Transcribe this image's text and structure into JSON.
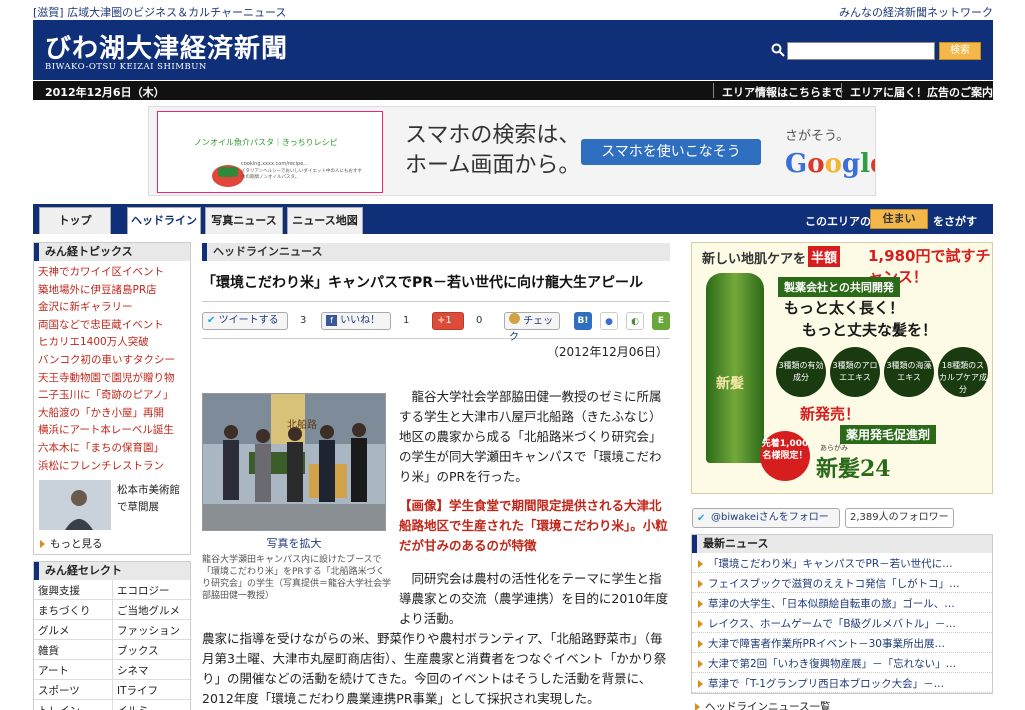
{
  "topbar": {
    "left": "[滋賀] 広域大津圏のビジネス＆カルチャーニュース",
    "right": "みんなの経済新聞ネットワーク"
  },
  "masthead": {
    "logo": "びわ湖大津経済新聞",
    "logo_sub": "BIWAKO-OTSU KEIZAI SHIMBUN",
    "search_placeholder": "",
    "search_button": "検索"
  },
  "datebar": {
    "date": "2012年12月6日（木）",
    "link1": "エリア情報はこちらまで",
    "link2": "エリアに届く！広告のご案内"
  },
  "banner": {
    "card_head": "ノンオイル魚介パスタ｜きっちりレシピ",
    "card_url": "cooking.xxxx.com/recipe...",
    "card_text": "イタリアンヘルシーでおいしいダイエット中の人にもおすすめの期間ノンオイルパスタ。",
    "message_line1": "スマホの検索は、",
    "message_line2": "ホーム画面から。",
    "cta": "スマホを使いこなそう",
    "tagline": "さがそう。",
    "brand": "Google",
    "brand_colors": [
      "#3b6fd8",
      "#d93b2b",
      "#f2b632",
      "#3b6fd8",
      "#2f9e44",
      "#d93b2b"
    ]
  },
  "nav": {
    "tabs": [
      "トップ",
      "ヘッドライン",
      "写真ニュース",
      "ニュース地図"
    ],
    "active_index": 1,
    "area_prefix": "このエリアの",
    "home_button": "住まい",
    "area_suffix": "をさがす"
  },
  "left": {
    "topics_title": "みん経トピックス",
    "topics": [
      "天神でカワイイ区イベント",
      "築地場外に伊豆諸島PR店",
      "金沢に新ギャラリー",
      "両国などで忠臣蔵イベント",
      "ヒカリエ1400万人突破",
      "バンコク初の車いすタクシー",
      "天王寺動物園で園児が贈り物",
      "二子玉川に「奇跡のピアノ」",
      "大船渡の「かき小屋」再開",
      "横浜にアート本レーベル誕生",
      "六本木に「まちの保育園」",
      "浜松にフレンチレストラン"
    ],
    "photo_caption": "松本市美術館で草間展",
    "more": "もっと見る",
    "select_title": "みん経セレクト",
    "select_items": [
      "復興支援",
      "エコロジー",
      "まちづくり",
      "ご当地グルメ",
      "グルメ",
      "ファッション",
      "雑貨",
      "ブックス",
      "アート",
      "シネマ",
      "スポーツ",
      "ITライフ",
      "トレイン",
      "イルミ"
    ]
  },
  "article": {
    "section": "ヘッドラインニュース",
    "headline": "「環境こだわり米」キャンパスでPR－若い世代に向け龍大生アピール",
    "social": {
      "tweet": "ツイートする",
      "tweet_count": "3",
      "like": "いいね！",
      "like_count": "1",
      "plus": "+1",
      "plus_count": "0",
      "check": "チェック",
      "hatena": "B!"
    },
    "date": "（2012年12月06日）",
    "photo_link": "写真を拡大",
    "photo_caption": "龍谷大学瀬田キャンパス内に設けたブースで「環境こだわり米」をPRする「北船路米づくり研究会」の学生（写真提供＝龍谷大学社会学部脇田健一教授）",
    "photo_sign": "北船路",
    "para1": "龍谷大学社会学部脇田健一教授のゼミに所属する学生と大津市八屋戸北船路（きたふなじ）地区の農家から成る「北船路米づくり研究会」の学生が同大学瀬田キャンパスで「環境こだわり米」のPRを行った。",
    "image_note": "【画像】学生食堂で期間限定提供される大津北船路地区で生産された「環境こだわり米」。小粒だが甘みのあるのが特徴",
    "para2": "同研究会は農村の活性化をテーマに学生と指導農家との交流（農学連携）を目的に2010年度より活動。",
    "para3": "農家に指導を受けながらの米、野菜作りや農村ボランティア、「北船路野菜市」（毎月第3土曜、大津市丸屋町商店街）、生産農家と消費者をつなぐイベント「かかり祭り」の開催などの活動を続けてきた。今回のイベントはそうした活動を背景に、2012年度「環境こだわり農業連携PR事業」として採択され実現した。"
  },
  "right": {
    "ad": {
      "top": "新しい地肌ケアを",
      "half": "半額",
      "price": "1,980円で試すチャンス！",
      "maker": "製薬会社との共同開発",
      "slogan1": "もっと太く長く！",
      "slogan2": "もっと丈夫な髪を！",
      "circles": [
        "3種類の有効成分",
        "3種類のアロエエキス",
        "3種類の海藻エキス",
        "18種類のスカルプケア成分"
      ],
      "new": "新発売！",
      "drug": "薬用発毛促進剤",
      "limited": "先着1,000名様限定！",
      "ruby": "あらがみ",
      "name": "新髪24",
      "bottle_label": "新髪"
    },
    "follow": "@biwakeiさんをフォロー",
    "followers": "2,389人のフォロワー",
    "news_title": "最新ニュース",
    "news": [
      "「環境こだわり米」キャンパスでPR－若い世代に…",
      "フェイスブックで滋賀のええトコ発信「しがトコ」…",
      "草津の大学生、「日本似顔絵自転車の旅」ゴール、…",
      "レイクス、ホームゲームで「B級グルメバトル」－…",
      "大津で障害者作業所PRイベント－30事業所出展…",
      "大津で第2回「いわき復興物産展」－「忘れない」…",
      "草津で「T-1グランプリ西日本ブロック大会」－…"
    ],
    "list_link": "ヘッドラインニュース一覧"
  }
}
